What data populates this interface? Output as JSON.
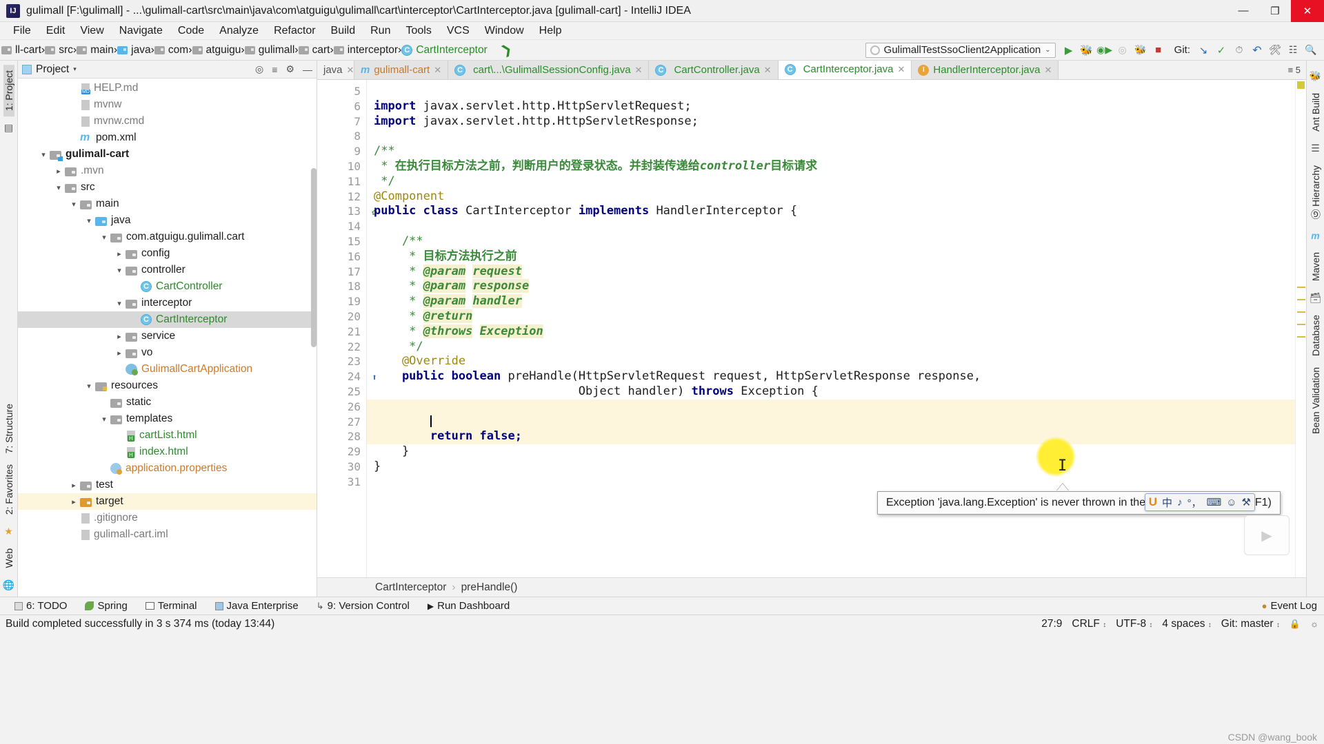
{
  "window": {
    "title": "gulimall [F:\\gulimall] - ...\\gulimall-cart\\src\\main\\java\\com\\atguigu\\gulimall\\cart\\interceptor\\CartInterceptor.java [gulimall-cart] - IntelliJ IDEA",
    "logo": "IJ",
    "minimize": "—",
    "maximize": "❐",
    "close": "✕"
  },
  "menu": [
    "File",
    "Edit",
    "View",
    "Navigate",
    "Code",
    "Analyze",
    "Refactor",
    "Build",
    "Run",
    "Tools",
    "VCS",
    "Window",
    "Help"
  ],
  "navbar": {
    "crumbs": [
      {
        "label": "ll-cart",
        "icon": "folder-icon",
        "style": "plain"
      },
      {
        "label": "src",
        "icon": "folder-icon",
        "style": "plain"
      },
      {
        "label": "main",
        "icon": "folder-icon",
        "style": "plain"
      },
      {
        "label": "java",
        "icon": "folder-blue-icon",
        "style": "plain"
      },
      {
        "label": "com",
        "icon": "folder-icon",
        "style": "plain"
      },
      {
        "label": "atguigu",
        "icon": "folder-icon",
        "style": "plain"
      },
      {
        "label": "gulimall",
        "icon": "folder-icon",
        "style": "plain"
      },
      {
        "label": "cart",
        "icon": "folder-icon",
        "style": "plain"
      },
      {
        "label": "interceptor",
        "icon": "folder-icon",
        "style": "plain"
      },
      {
        "label": "CartInterceptor",
        "icon": "class-icon",
        "style": "green"
      }
    ],
    "run_config": "GulimallTestSsoClient2Application",
    "run_config_chevron": "⌄",
    "git_label": "Git:",
    "buttons": [
      "run-button",
      "debug-button",
      "run-with-coverage-button",
      "profile-button",
      "build-button",
      "stop-button"
    ],
    "git_buttons": [
      "update-project-button",
      "commit-button",
      "push-button",
      "history-button",
      "rollback-button"
    ]
  },
  "left_strip": {
    "project": "1: Project",
    "structure": "7: Structure",
    "favorites": "2: Favorites",
    "web": "Web"
  },
  "right_strip": {
    "ant": "Ant Build",
    "hierarchy": "Ⓖ Hierarchy",
    "maven": "Maven",
    "database": "Database",
    "bean": "Bean Validation"
  },
  "project_panel": {
    "title": "Project",
    "caret": "▾",
    "actions": [
      "target-icon",
      "collapse-all-icon",
      "gear-icon",
      "hide-icon"
    ],
    "tree": [
      {
        "label": "HELP.md",
        "indent": 3,
        "twisty": "",
        "icon": "md-file-icon",
        "color": "gray"
      },
      {
        "label": "mvnw",
        "indent": 3,
        "twisty": "",
        "icon": "file-icon",
        "color": "gray"
      },
      {
        "label": "mvnw.cmd",
        "indent": 3,
        "twisty": "",
        "icon": "file-icon",
        "color": "gray"
      },
      {
        "label": "pom.xml",
        "indent": 3,
        "twisty": "",
        "icon": "maven-icon",
        "color": "black"
      },
      {
        "label": "gulimall-cart",
        "indent": 1,
        "twisty": "⌄",
        "icon": "module-folder-icon",
        "color": "bold"
      },
      {
        "label": ".mvn",
        "indent": 2,
        "twisty": "›",
        "icon": "folder-icon",
        "color": "gray"
      },
      {
        "label": "src",
        "indent": 2,
        "twisty": "⌄",
        "icon": "folder-icon",
        "color": "black"
      },
      {
        "label": "main",
        "indent": 3,
        "twisty": "⌄",
        "icon": "folder-icon",
        "color": "black"
      },
      {
        "label": "java",
        "indent": 4,
        "twisty": "⌄",
        "icon": "folder-blue-icon",
        "color": "black"
      },
      {
        "label": "com.atguigu.gulimall.cart",
        "indent": 5,
        "twisty": "⌄",
        "icon": "package-icon",
        "color": "black"
      },
      {
        "label": "config",
        "indent": 6,
        "twisty": "›",
        "icon": "package-icon",
        "color": "black"
      },
      {
        "label": "controller",
        "indent": 6,
        "twisty": "⌄",
        "icon": "package-icon",
        "color": "black"
      },
      {
        "label": "CartController",
        "indent": 7,
        "twisty": "",
        "icon": "class-icon",
        "color": "green"
      },
      {
        "label": "interceptor",
        "indent": 6,
        "twisty": "⌄",
        "icon": "package-icon",
        "color": "black"
      },
      {
        "label": "CartInterceptor",
        "indent": 7,
        "twisty": "",
        "icon": "class-icon",
        "color": "green",
        "selected": true
      },
      {
        "label": "service",
        "indent": 6,
        "twisty": "›",
        "icon": "package-icon",
        "color": "black"
      },
      {
        "label": "vo",
        "indent": 6,
        "twisty": "›",
        "icon": "package-icon",
        "color": "black"
      },
      {
        "label": "GulimallCartApplication",
        "indent": 6,
        "twisty": "",
        "icon": "spring-boot-icon",
        "color": "orange"
      },
      {
        "label": "resources",
        "indent": 4,
        "twisty": "⌄",
        "icon": "resources-folder-icon",
        "color": "black"
      },
      {
        "label": "static",
        "indent": 5,
        "twisty": "",
        "icon": "package-icon",
        "color": "black"
      },
      {
        "label": "templates",
        "indent": 5,
        "twisty": "⌄",
        "icon": "package-icon",
        "color": "black"
      },
      {
        "label": "cartList.html",
        "indent": 6,
        "twisty": "",
        "icon": "html-file-icon",
        "color": "green"
      },
      {
        "label": "index.html",
        "indent": 6,
        "twisty": "",
        "icon": "html-file-icon",
        "color": "green"
      },
      {
        "label": "application.properties",
        "indent": 5,
        "twisty": "",
        "icon": "properties-icon",
        "color": "orange"
      },
      {
        "label": "test",
        "indent": 3,
        "twisty": "›",
        "icon": "folder-icon",
        "color": "black"
      },
      {
        "label": "target",
        "indent": 3,
        "twisty": "›",
        "icon": "target-folder-icon",
        "color": "black",
        "row_highlight": true
      },
      {
        "label": ".gitignore",
        "indent": 3,
        "twisty": "",
        "icon": "file-icon",
        "color": "gray"
      },
      {
        "label": "gulimall-cart.iml",
        "indent": 3,
        "twisty": "",
        "icon": "file-icon",
        "color": "gray"
      }
    ]
  },
  "editor": {
    "tabs": [
      {
        "label": "java",
        "icon": "none",
        "active": false,
        "closable": true
      },
      {
        "label": "gulimall-cart",
        "icon": "maven-icon",
        "active": false,
        "closable": true
      },
      {
        "label": "cart\\...\\GulimallSessionConfig.java",
        "icon": "class-icon",
        "active": false,
        "closable": true
      },
      {
        "label": "CartController.java",
        "icon": "class-icon",
        "active": false,
        "closable": true
      },
      {
        "label": "CartInterceptor.java",
        "icon": "class-icon",
        "active": true,
        "closable": true
      },
      {
        "label": "HandlerInterceptor.java",
        "icon": "interface-icon",
        "active": false,
        "closable": true
      }
    ],
    "tab_overflow": "≡ 5",
    "first_line_number": 5,
    "lines": [
      {
        "n": 5,
        "segs": []
      },
      {
        "n": 6,
        "segs": [
          {
            "t": "import ",
            "c": "kw"
          },
          {
            "t": "javax.servlet.http.HttpServletRequest;",
            "c": ""
          }
        ]
      },
      {
        "n": 7,
        "segs": [
          {
            "t": "import ",
            "c": "kw"
          },
          {
            "t": "javax.servlet.http.HttpServletResponse;",
            "c": ""
          }
        ],
        "fold": true
      },
      {
        "n": 8,
        "segs": []
      },
      {
        "n": 9,
        "segs": [
          {
            "t": "/**",
            "c": "jdoc"
          }
        ],
        "fold": true
      },
      {
        "n": 10,
        "segs": [
          {
            "t": " * ",
            "c": "jdoc"
          },
          {
            "t": "在执行目标方法之前，判断用户的登录状态。并封装传递给",
            "c": "cmtgreen"
          },
          {
            "t": "controller",
            "c": "cmtgreen ital"
          },
          {
            "t": "目标请求",
            "c": "cmtgreen"
          }
        ]
      },
      {
        "n": 11,
        "segs": [
          {
            "t": " */",
            "c": "jdoc"
          }
        ],
        "fold": true
      },
      {
        "n": 12,
        "segs": [
          {
            "t": "@Component",
            "c": "ann"
          }
        ]
      },
      {
        "n": 13,
        "segs": [
          {
            "t": "public ",
            "c": "kw"
          },
          {
            "t": "class ",
            "c": "kw"
          },
          {
            "t": "CartInterceptor ",
            "c": ""
          },
          {
            "t": "implements ",
            "c": "kw"
          },
          {
            "t": "HandlerInterceptor {",
            "c": ""
          }
        ],
        "gutter_icon": "spring-bean-icon"
      },
      {
        "n": 14,
        "segs": []
      },
      {
        "n": 15,
        "segs": [
          {
            "t": "    /**",
            "c": "jdoc"
          }
        ]
      },
      {
        "n": 16,
        "segs": [
          {
            "t": "     * ",
            "c": "jdoc"
          },
          {
            "t": "目标方法执行之前",
            "c": "cmtgreen"
          }
        ]
      },
      {
        "n": 17,
        "segs": [
          {
            "t": "     * ",
            "c": "jdoc"
          },
          {
            "t": "@param",
            "c": "jtag"
          },
          {
            "t": " ",
            "c": ""
          },
          {
            "t": "request",
            "c": "jparam"
          }
        ]
      },
      {
        "n": 18,
        "segs": [
          {
            "t": "     * ",
            "c": "jdoc"
          },
          {
            "t": "@param",
            "c": "jtag"
          },
          {
            "t": " ",
            "c": ""
          },
          {
            "t": "response",
            "c": "jparam"
          }
        ]
      },
      {
        "n": 19,
        "segs": [
          {
            "t": "     * ",
            "c": "jdoc"
          },
          {
            "t": "@param",
            "c": "jtag"
          },
          {
            "t": " ",
            "c": ""
          },
          {
            "t": "handler",
            "c": "jparam"
          }
        ]
      },
      {
        "n": 20,
        "segs": [
          {
            "t": "     * ",
            "c": "jdoc"
          },
          {
            "t": "@return",
            "c": "jtag"
          }
        ]
      },
      {
        "n": 21,
        "segs": [
          {
            "t": "     * ",
            "c": "jdoc"
          },
          {
            "t": "@throws",
            "c": "jtag"
          },
          {
            "t": " ",
            "c": ""
          },
          {
            "t": "Exception",
            "c": "jparam"
          }
        ]
      },
      {
        "n": 22,
        "segs": [
          {
            "t": "     */",
            "c": "jdoc"
          }
        ],
        "fold": true
      },
      {
        "n": 23,
        "segs": [
          {
            "t": "    @Override",
            "c": "ann"
          }
        ]
      },
      {
        "n": 24,
        "segs": [
          {
            "t": "    public ",
            "c": "kw"
          },
          {
            "t": "boolean ",
            "c": "kw"
          },
          {
            "t": "preHandle(HttpServletRequest request, HttpServletResponse response,",
            "c": ""
          }
        ],
        "gutter_icon": "override-icon"
      },
      {
        "n": 25,
        "segs": [
          {
            "t": "                             Object handler) ",
            "c": ""
          },
          {
            "t": "throws ",
            "c": "kw"
          },
          {
            "t": "Exception {",
            "c": ""
          }
        ],
        "fold": true
      },
      {
        "n": 26,
        "segs": [],
        "hl": true
      },
      {
        "n": 27,
        "segs": [],
        "hl": true,
        "caret": true
      },
      {
        "n": 28,
        "segs": [
          {
            "t": "        return ",
            "c": "kw"
          },
          {
            "t": "false;",
            "c": "kw"
          }
        ],
        "hl": true
      },
      {
        "n": 29,
        "segs": [
          {
            "t": "    }",
            "c": ""
          }
        ],
        "fold": true
      },
      {
        "n": 30,
        "segs": [
          {
            "t": "}",
            "c": ""
          }
        ]
      },
      {
        "n": 31,
        "segs": []
      }
    ],
    "tooltip": {
      "text": "Exception 'java.lang.Exception' is never thrown in the method ",
      "link": "more…",
      "shortcut": " (Ctrl+F1)"
    },
    "breadcrumb": [
      "CartInterceptor",
      "preHandle()"
    ],
    "breadcrumb_sep": "›"
  },
  "ime_bar": {
    "items": [
      "中",
      "♪",
      "°，",
      "⌨",
      "☺",
      "⚒"
    ],
    "logo": "U"
  },
  "bottom_tools": [
    {
      "label": "6: TODO",
      "icon": "todo-icon"
    },
    {
      "label": "Spring",
      "icon": "spring-icon"
    },
    {
      "label": "Terminal",
      "icon": "terminal-icon"
    },
    {
      "label": "Java Enterprise",
      "icon": "java-ee-icon"
    },
    {
      "label": "9: Version Control",
      "icon": "vcs-icon"
    },
    {
      "label": "Run Dashboard",
      "icon": "run-dashboard-icon"
    }
  ],
  "event_log": {
    "label": "Event Log",
    "icon": "event-log-icon"
  },
  "status_bar": {
    "message": "Build completed successfully in 3 s 374 ms (today 13:44)",
    "caret_position": "27:9",
    "line_separator": "CRLF",
    "encoding": "UTF-8",
    "indent": "4 spaces",
    "git_branch": "Git: master",
    "chevron": "⌄",
    "lock_icon": "lock-icon",
    "notify_icon": "balloon-icon"
  },
  "watermark": "CSDN @wang_book"
}
